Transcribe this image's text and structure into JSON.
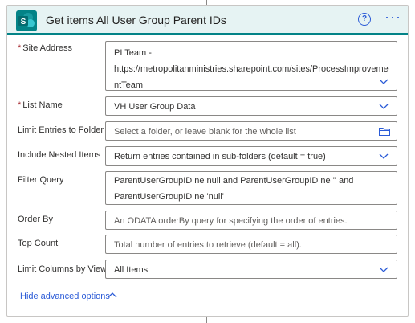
{
  "header": {
    "title": "Get items All User Group Parent IDs",
    "icons": {
      "app": "sharepoint-logo-icon",
      "help": "help-icon",
      "more": "more-options-icon"
    }
  },
  "fields": {
    "site_address": {
      "label": "Site Address",
      "required_mark": "*",
      "line1": "PI Team -",
      "line2": "https://metropolitanministries.sharepoint.com/sites/ProcessImproveme",
      "line3": "ntTeam"
    },
    "list_name": {
      "label": "List Name",
      "required_mark": "*",
      "value": "VH User Group Data"
    },
    "limit_entries": {
      "label": "Limit Entries to Folder",
      "placeholder": "Select a folder, or leave blank for the whole list"
    },
    "nested_items": {
      "label": "Include Nested Items",
      "value": "Return entries contained in sub-folders (default = true)"
    },
    "filter_query": {
      "label": "Filter Query",
      "line1": "ParentUserGroupID ne null and ParentUserGroupID ne '' and",
      "line2": "ParentUserGroupID ne 'null'"
    },
    "order_by": {
      "label": "Order By",
      "placeholder": "An ODATA orderBy query for specifying the order of entries."
    },
    "top_count": {
      "label": "Top Count",
      "placeholder": "Total number of entries to retrieve (default = all)."
    },
    "limit_columns": {
      "label": "Limit Columns by View",
      "value": "All Items"
    }
  },
  "footer": {
    "hide_advanced": "Hide advanced options"
  },
  "colors": {
    "accent": "#038387",
    "link": "#2b5bd7",
    "required": "#a4262c",
    "header_bg": "#e6f3f3"
  }
}
